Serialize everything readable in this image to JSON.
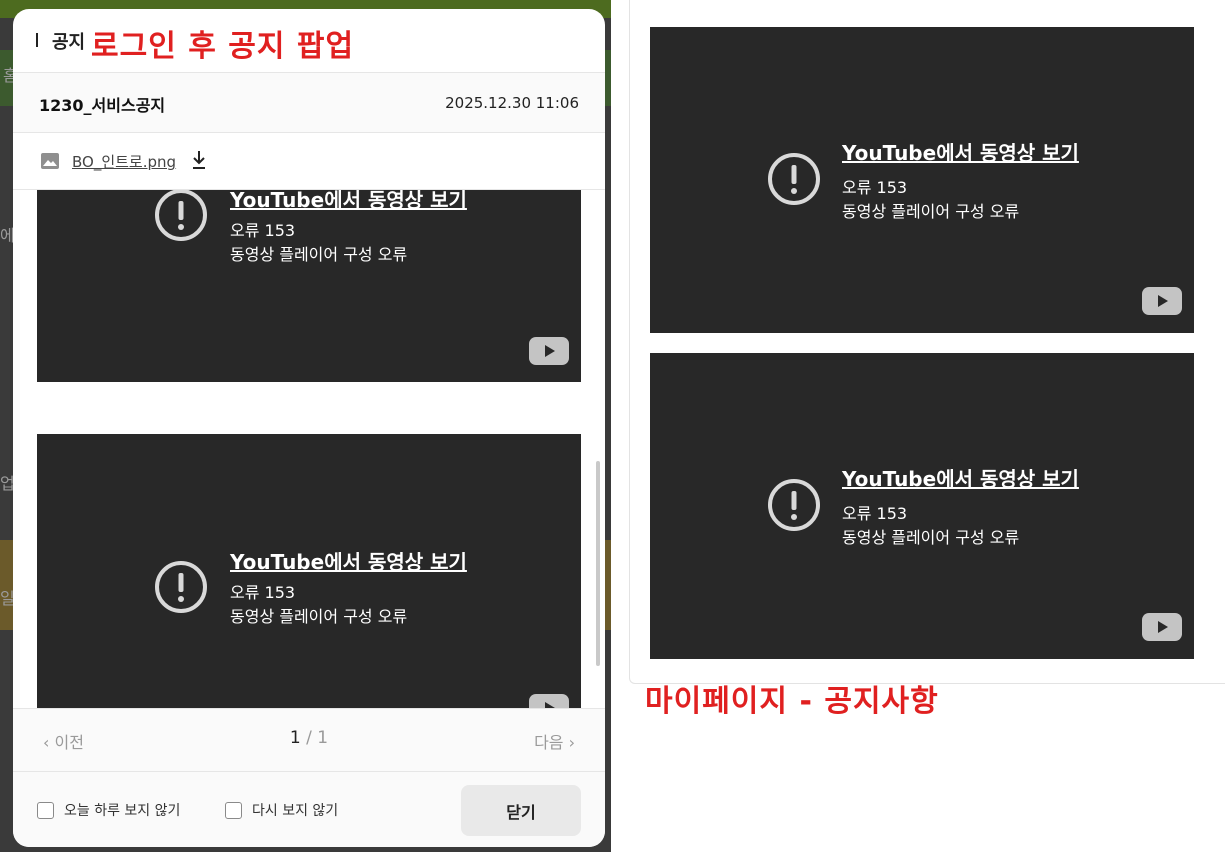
{
  "popup": {
    "header_title": "공지",
    "annotation": "로그인 후 공지 팝업",
    "notice": {
      "title": "1230_서비스공지",
      "date": "2025.12.30 11:06"
    },
    "attachment": {
      "file_name": "BO_인트로.png",
      "icon": "image-icon",
      "download_icon": "download-icon"
    },
    "pagination": {
      "prev_label": "이전",
      "current": "1",
      "separator": " / ",
      "total": "1",
      "next_label": "다음"
    },
    "footer": {
      "hide_today_label": "오늘 하루 보지 않기",
      "never_show_label": "다시 보지 않기",
      "close_label": "닫기"
    }
  },
  "video_error": {
    "link_text": "YouTube에서 동영상 보기",
    "error_code": "오류 153",
    "error_message": "동영상 플레이어 구성 오류"
  },
  "mypage": {
    "annotation": "마이페이지 - 공지사항"
  },
  "background_fragments": [
    "홈",
    "에",
    "업",
    "일"
  ],
  "colors": {
    "annotation_red": "#e02020",
    "video_bg": "#282828",
    "overlay": "#3a3a3a"
  }
}
